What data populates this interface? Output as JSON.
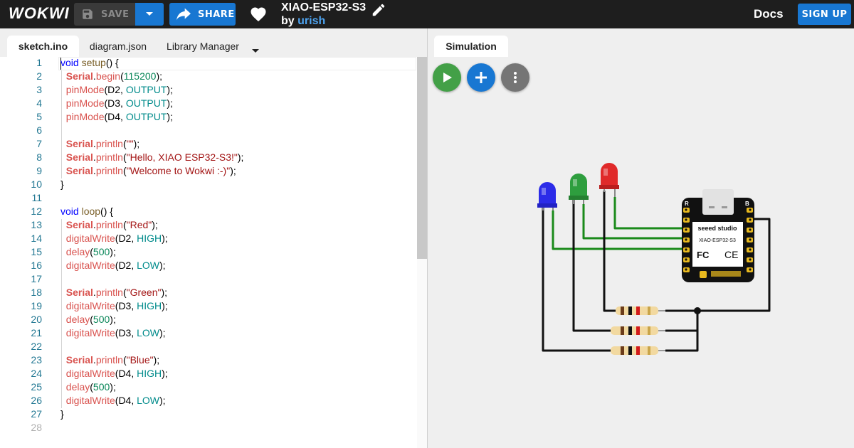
{
  "header": {
    "logo": "WOKWI",
    "save_label": "SAVE",
    "share_label": "SHARE",
    "project_title": "XIAO-ESP32-S3",
    "by_prefix": "by",
    "author": "urish",
    "docs_label": "Docs",
    "signup_label": "SIGN UP"
  },
  "editor": {
    "tabs": [
      {
        "label": "sketch.ino",
        "active": true
      },
      {
        "label": "diagram.json",
        "active": false
      },
      {
        "label": "Library Manager",
        "active": false
      }
    ],
    "code_lines": [
      [
        [
          "void",
          "kw"
        ],
        [
          " ",
          ""
        ],
        [
          "setup",
          "fn"
        ],
        [
          "() {",
          ""
        ]
      ],
      [
        [
          "  ",
          ""
        ],
        [
          "Serial",
          "obj"
        ],
        [
          ".",
          ""
        ],
        [
          "begin",
          "call"
        ],
        [
          "(",
          ""
        ],
        [
          "115200",
          "num"
        ],
        [
          ");",
          ""
        ]
      ],
      [
        [
          "  ",
          ""
        ],
        [
          "pinMode",
          "call"
        ],
        [
          "(D2, ",
          ""
        ],
        [
          "OUTPUT",
          "const"
        ],
        [
          ");",
          ""
        ]
      ],
      [
        [
          "  ",
          ""
        ],
        [
          "pinMode",
          "call"
        ],
        [
          "(D3, ",
          ""
        ],
        [
          "OUTPUT",
          "const"
        ],
        [
          ");",
          ""
        ]
      ],
      [
        [
          "  ",
          ""
        ],
        [
          "pinMode",
          "call"
        ],
        [
          "(D4, ",
          ""
        ],
        [
          "OUTPUT",
          "const"
        ],
        [
          ");",
          ""
        ]
      ],
      [],
      [
        [
          "  ",
          ""
        ],
        [
          "Serial",
          "obj"
        ],
        [
          ".",
          ""
        ],
        [
          "println",
          "call"
        ],
        [
          "(",
          ""
        ],
        [
          "\"\"",
          "str"
        ],
        [
          ");",
          ""
        ]
      ],
      [
        [
          "  ",
          ""
        ],
        [
          "Serial",
          "obj"
        ],
        [
          ".",
          ""
        ],
        [
          "println",
          "call"
        ],
        [
          "(",
          ""
        ],
        [
          "\"Hello, XIAO ESP32-S3!\"",
          "str"
        ],
        [
          ");",
          ""
        ]
      ],
      [
        [
          "  ",
          ""
        ],
        [
          "Serial",
          "obj"
        ],
        [
          ".",
          ""
        ],
        [
          "println",
          "call"
        ],
        [
          "(",
          ""
        ],
        [
          "\"Welcome to Wokwi :-)\"",
          "str"
        ],
        [
          ");",
          ""
        ]
      ],
      [
        [
          "}",
          ""
        ]
      ],
      [],
      [
        [
          "void",
          "kw"
        ],
        [
          " ",
          ""
        ],
        [
          "loop",
          "fn"
        ],
        [
          "() {",
          ""
        ]
      ],
      [
        [
          "  ",
          ""
        ],
        [
          "Serial",
          "obj"
        ],
        [
          ".",
          ""
        ],
        [
          "println",
          "call"
        ],
        [
          "(",
          ""
        ],
        [
          "\"Red\"",
          "str"
        ],
        [
          ");",
          ""
        ]
      ],
      [
        [
          "  ",
          ""
        ],
        [
          "digitalWrite",
          "call"
        ],
        [
          "(D2, ",
          ""
        ],
        [
          "HIGH",
          "const"
        ],
        [
          ");",
          ""
        ]
      ],
      [
        [
          "  ",
          ""
        ],
        [
          "delay",
          "call"
        ],
        [
          "(",
          ""
        ],
        [
          "500",
          "num"
        ],
        [
          ");",
          ""
        ]
      ],
      [
        [
          "  ",
          ""
        ],
        [
          "digitalWrite",
          "call"
        ],
        [
          "(D2, ",
          ""
        ],
        [
          "LOW",
          "const"
        ],
        [
          ");",
          ""
        ]
      ],
      [],
      [
        [
          "  ",
          ""
        ],
        [
          "Serial",
          "obj"
        ],
        [
          ".",
          ""
        ],
        [
          "println",
          "call"
        ],
        [
          "(",
          ""
        ],
        [
          "\"Green\"",
          "str"
        ],
        [
          ");",
          ""
        ]
      ],
      [
        [
          "  ",
          ""
        ],
        [
          "digitalWrite",
          "call"
        ],
        [
          "(D3, ",
          ""
        ],
        [
          "HIGH",
          "const"
        ],
        [
          ");",
          ""
        ]
      ],
      [
        [
          "  ",
          ""
        ],
        [
          "delay",
          "call"
        ],
        [
          "(",
          ""
        ],
        [
          "500",
          "num"
        ],
        [
          ");",
          ""
        ]
      ],
      [
        [
          "  ",
          ""
        ],
        [
          "digitalWrite",
          "call"
        ],
        [
          "(D3, ",
          ""
        ],
        [
          "LOW",
          "const"
        ],
        [
          ");",
          ""
        ]
      ],
      [],
      [
        [
          "  ",
          ""
        ],
        [
          "Serial",
          "obj"
        ],
        [
          ".",
          ""
        ],
        [
          "println",
          "call"
        ],
        [
          "(",
          ""
        ],
        [
          "\"Blue\"",
          "str"
        ],
        [
          ");",
          ""
        ]
      ],
      [
        [
          "  ",
          ""
        ],
        [
          "digitalWrite",
          "call"
        ],
        [
          "(D4, ",
          ""
        ],
        [
          "HIGH",
          "const"
        ],
        [
          ");",
          ""
        ]
      ],
      [
        [
          "  ",
          ""
        ],
        [
          "delay",
          "call"
        ],
        [
          "(",
          ""
        ],
        [
          "500",
          "num"
        ],
        [
          ");",
          ""
        ]
      ],
      [
        [
          "  ",
          ""
        ],
        [
          "digitalWrite",
          "call"
        ],
        [
          "(D4, ",
          ""
        ],
        [
          "LOW",
          "const"
        ],
        [
          ");",
          ""
        ]
      ],
      [
        [
          "}",
          ""
        ]
      ],
      []
    ]
  },
  "simulation": {
    "tab_label": "Simulation",
    "board_brand": "seeed studio",
    "board_model": "XIAO-ESP32-S3",
    "board_cert_fc": "FC",
    "board_cert_ce": "CE",
    "board_pin_r": "R",
    "board_pin_b": "B",
    "leds": [
      {
        "color_name": "blue",
        "color": "#2b2be8"
      },
      {
        "color_name": "green",
        "color": "#2e9e3e"
      },
      {
        "color_name": "red",
        "color": "#e02a2a"
      }
    ]
  },
  "colors": {
    "topbar": "#1e1e1e",
    "accent_blue": "#1877d2",
    "play_green": "#43a047",
    "wire_green": "#1a8a1a",
    "wire_black": "#111111"
  },
  "icons": {
    "save": "floppy-disk-icon",
    "dropdown": "chevron-down-icon",
    "share": "share-arrow-icon",
    "like": "heart-icon",
    "edit": "pencil-icon",
    "play": "play-icon",
    "add": "plus-icon",
    "more": "more-vertical-icon"
  }
}
